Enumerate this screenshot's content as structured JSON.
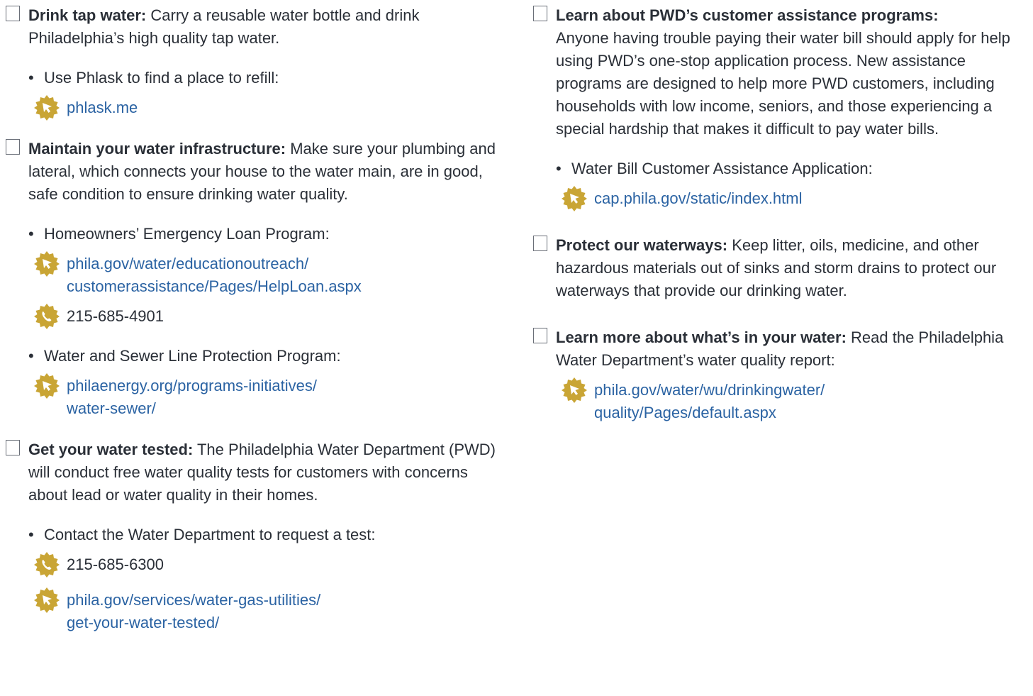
{
  "left": {
    "drink": {
      "title": "Drink tap water:",
      "text": " Carry a reusable water bottle and drink Philadelphia’s high quality tap water.",
      "bullet": "Use Phlask to find a place to refill:",
      "link": "phlask.me"
    },
    "maintain": {
      "title": "Maintain your water infrastructure:",
      "text": " Make sure your plumbing and lateral, which connects your house to the water main, are in good, safe condition to ensure drinking water quality.",
      "bullet1": "Homeowners’ Emergency Loan Program:",
      "link1a": "phila.gov/water/educationoutreach/",
      "link1b": "customerassistance/Pages/HelpLoan.aspx",
      "phone1": "215-685-4901",
      "bullet2": "Water and Sewer Line Protection Program:",
      "link2a": "philaenergy.org/programs-initiatives/",
      "link2b": "water-sewer/"
    },
    "tested": {
      "title": "Get your water tested:",
      "text": " The Philadelphia Water Department (PWD) will conduct free water quality tests for customers with concerns about lead or water quality in their homes.",
      "bullet": "Contact the Water Department to request a test:",
      "phone": "215-685-6300",
      "linka": "phila.gov/services/water-gas-utilities/",
      "linkb": "get-your-water-tested/"
    }
  },
  "right": {
    "assist": {
      "title": "Learn about PWD’s customer assistance programs:",
      "text": "Anyone having trouble paying their water bill should apply for help using PWD’s one-stop application process. New assistance programs are designed to help more PWD customers, including households with low income, seniors, and those experiencing a special hardship that makes it difficult to pay water bills.",
      "bullet": "Water Bill Customer Assistance Application:",
      "link": "cap.phila.gov/static/index.html"
    },
    "protect": {
      "title": "Protect our waterways:",
      "text": " Keep litter, oils, medicine, and other hazardous materials out of sinks and storm drains to protect our waterways that provide our drinking water."
    },
    "learn": {
      "title": "Learn more about what’s in your water:",
      "text": " Read the Philadelphia Water Department’s water quality report:",
      "linka": "phila.gov/water/wu/drinkingwater/",
      "linkb": "quality/Pages/default.aspx"
    }
  },
  "icons": {
    "seal_color": "#c9a535",
    "icon_mark_color": "#ffffff"
  }
}
